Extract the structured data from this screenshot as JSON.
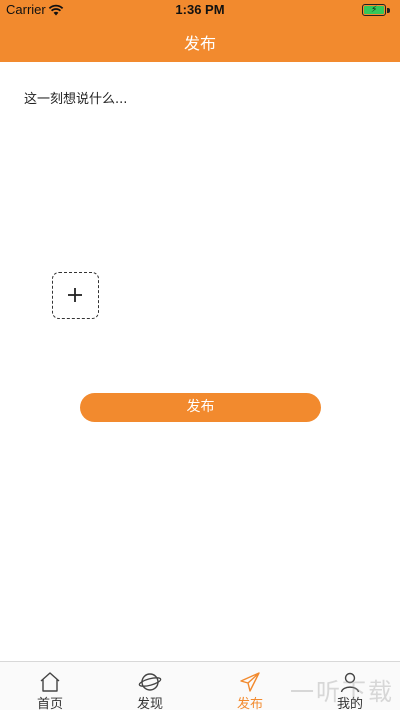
{
  "status_bar": {
    "carrier": "Carrier",
    "time": "1:36 PM",
    "wifi_icon": "wifi-icon",
    "battery_icon": "battery-icon"
  },
  "header": {
    "title": "发布"
  },
  "compose": {
    "placeholder": "这一刻想说什么..."
  },
  "add_image": {
    "icon": "plus-icon"
  },
  "publish_button": {
    "label": "发布"
  },
  "tabs": [
    {
      "label": "首页",
      "icon": "home-icon",
      "active": false
    },
    {
      "label": "发现",
      "icon": "planet-icon",
      "active": false
    },
    {
      "label": "发布",
      "icon": "paper-plane-icon",
      "active": true
    },
    {
      "label": "我的",
      "icon": "user-icon",
      "active": false
    }
  ],
  "watermark": {
    "text": "一听下载"
  },
  "colors": {
    "accent": "#f28a2e",
    "text": "#222222",
    "tab_border": "#d8d8d8"
  }
}
